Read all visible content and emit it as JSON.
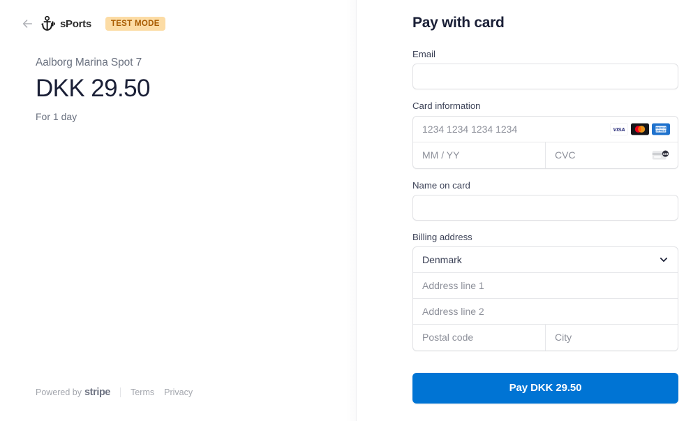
{
  "merchant": {
    "back_label": "Back",
    "logo_text": "sPorts",
    "logo_icon": "anchor-icon",
    "test_badge": "TEST MODE"
  },
  "product": {
    "name": "Aalborg Marina Spot 7",
    "amount": "DKK 29.50",
    "interval": "For 1 day"
  },
  "footer": {
    "powered_by": "Powered by",
    "stripe": "stripe",
    "terms": "Terms",
    "privacy": "Privacy"
  },
  "form": {
    "title": "Pay with card",
    "email": {
      "label": "Email",
      "value": "",
      "placeholder": ""
    },
    "card": {
      "label": "Card information",
      "number_placeholder": "1234 1234 1234 1234",
      "number_value": "",
      "expiry_placeholder": "MM / YY",
      "expiry_value": "",
      "cvc_placeholder": "CVC",
      "cvc_value": "",
      "brands": [
        "visa",
        "mastercard",
        "amex"
      ],
      "cvc_icon": "cvc-card-icon"
    },
    "name_on_card": {
      "label": "Name on card",
      "value": "",
      "placeholder": ""
    },
    "billing": {
      "label": "Billing address",
      "country_value": "Denmark",
      "country_icon": "chevron-down-icon",
      "address1_placeholder": "Address line 1",
      "address1_value": "",
      "address2_placeholder": "Address line 2",
      "address2_value": "",
      "postal_placeholder": "Postal code",
      "postal_value": "",
      "city_placeholder": "City",
      "city_value": ""
    },
    "submit_label": "Pay DKK 29.50"
  },
  "colors": {
    "accent": "#0074d4",
    "badge_bg": "#fcdca5",
    "badge_text": "#a85b00",
    "heading": "#1a1f36",
    "muted": "#6b7280"
  }
}
